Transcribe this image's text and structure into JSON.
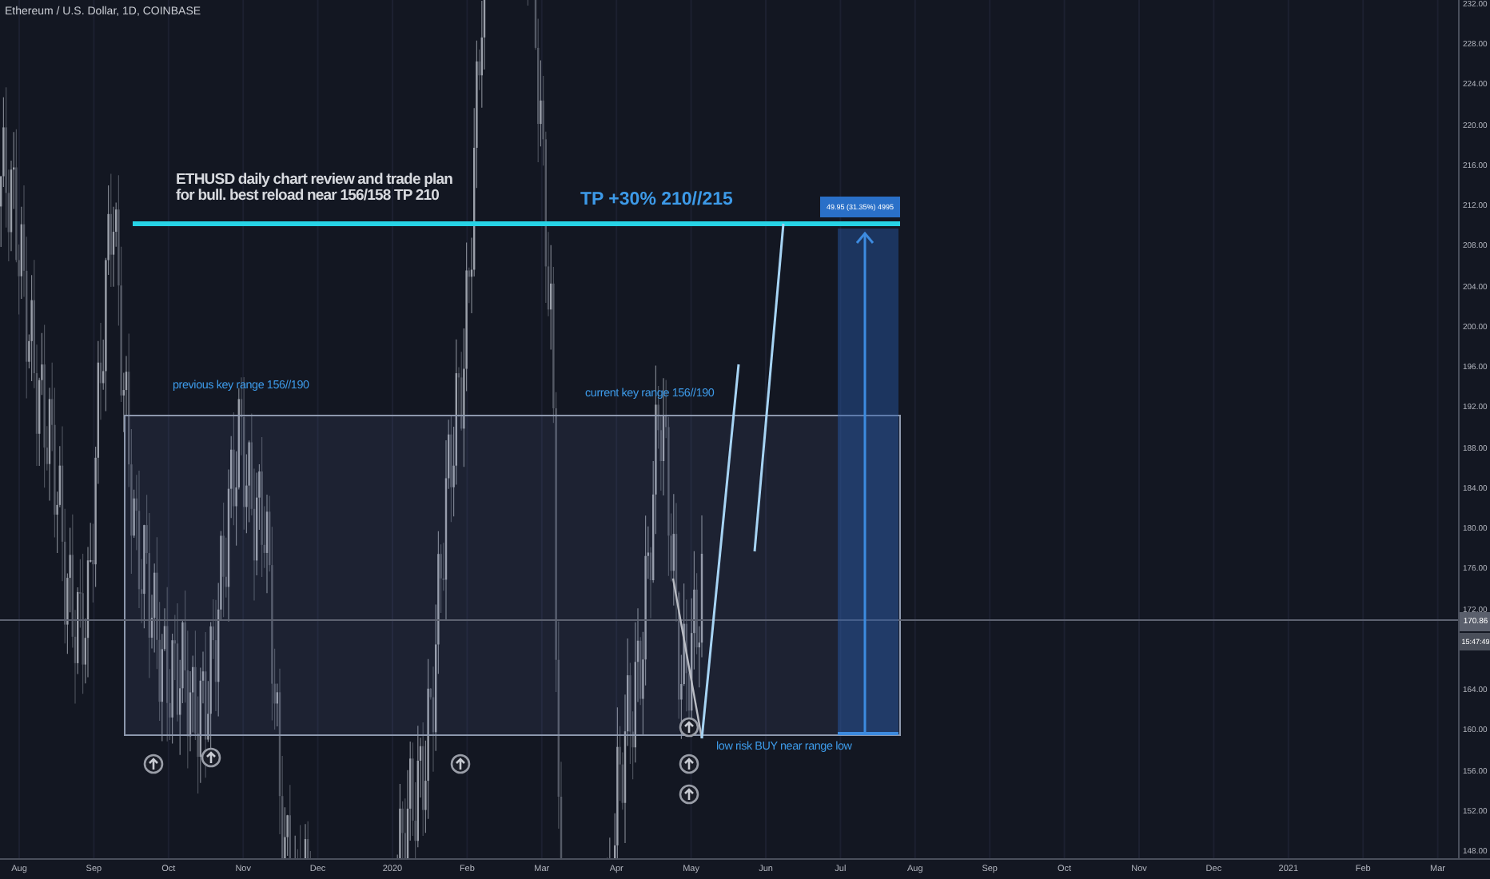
{
  "header": {
    "symbol": "Ethereum / U.S. Dollar, 1D, COINBASE"
  },
  "price_axis": {
    "ticks": [
      "232.00",
      "228.00",
      "224.00",
      "220.00",
      "216.00",
      "212.00",
      "208.00",
      "204.00",
      "200.00",
      "196.00",
      "192.00",
      "188.00",
      "184.00",
      "180.00",
      "176.00",
      "172.00",
      "164.00",
      "160.00",
      "156.00",
      "152.00",
      "148.00"
    ],
    "last_price": "170.86",
    "countdown": "15:47:49"
  },
  "time_axis": {
    "ticks": [
      "Aug",
      "Sep",
      "Oct",
      "Nov",
      "Dec",
      "2020",
      "Feb",
      "Mar",
      "Apr",
      "May",
      "Jun",
      "Jul",
      "Aug",
      "Sep",
      "Oct",
      "Nov",
      "Dec",
      "2021",
      "Feb",
      "Mar"
    ]
  },
  "annotations": [
    {
      "kind": "note",
      "text": "ETHUSD daily chart review and trade plan\nfor bull. best reload near 156/158 TP 210"
    },
    {
      "kind": "target",
      "text": "TP +30% 210//215"
    },
    {
      "kind": "label",
      "text": "previous key range 156//190"
    },
    {
      "kind": "label",
      "text": "current key range 156//190"
    },
    {
      "kind": "label",
      "text": "low risk BUY near range low"
    }
  ],
  "measure": {
    "label": "49.95 (31.35%) 4995"
  }
}
